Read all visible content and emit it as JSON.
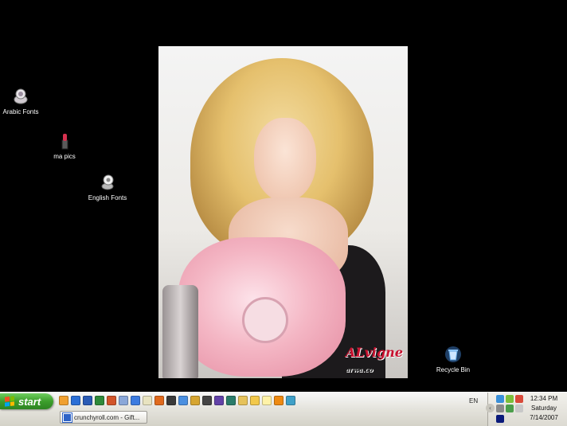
{
  "desktop": {
    "icons": [
      {
        "label": "Arabic Fonts",
        "icon": "font-folder-icon"
      },
      {
        "label": "ma pics",
        "icon": "lipstick-folder-icon"
      },
      {
        "label": "English Fonts",
        "icon": "font-folder-icon"
      },
      {
        "label": "Recycle Bin",
        "icon": "recycle-bin-icon"
      }
    ],
    "wallpaper": {
      "signature_main": "ALvigne",
      "signature_sub": "arwa.co"
    }
  },
  "taskbar": {
    "start_label": "start",
    "quick_launch": [
      "browser-icon",
      "ie-icon",
      "word-icon",
      "excel-icon",
      "powerpoint-icon",
      "media-icon",
      "ie-icon",
      "paint-icon",
      "firefox-icon",
      "winamp-icon",
      "messenger-icon",
      "gear-icon",
      "steam-icon",
      "media-player-icon",
      "globe-icon",
      "mail-icon",
      "folder-icon",
      "notes-icon",
      "vlc-icon",
      "network-icon"
    ],
    "task_button": "crunchyroll.com - Gift...",
    "language": "EN",
    "clock": {
      "time": "12:34 PM",
      "day": "Saturday",
      "date": "7/14/2007"
    }
  },
  "colors": {
    "desktop_bg": "#000000",
    "start_green": "#3c9e2c",
    "taskbar_bg": "#e4e3dc"
  }
}
